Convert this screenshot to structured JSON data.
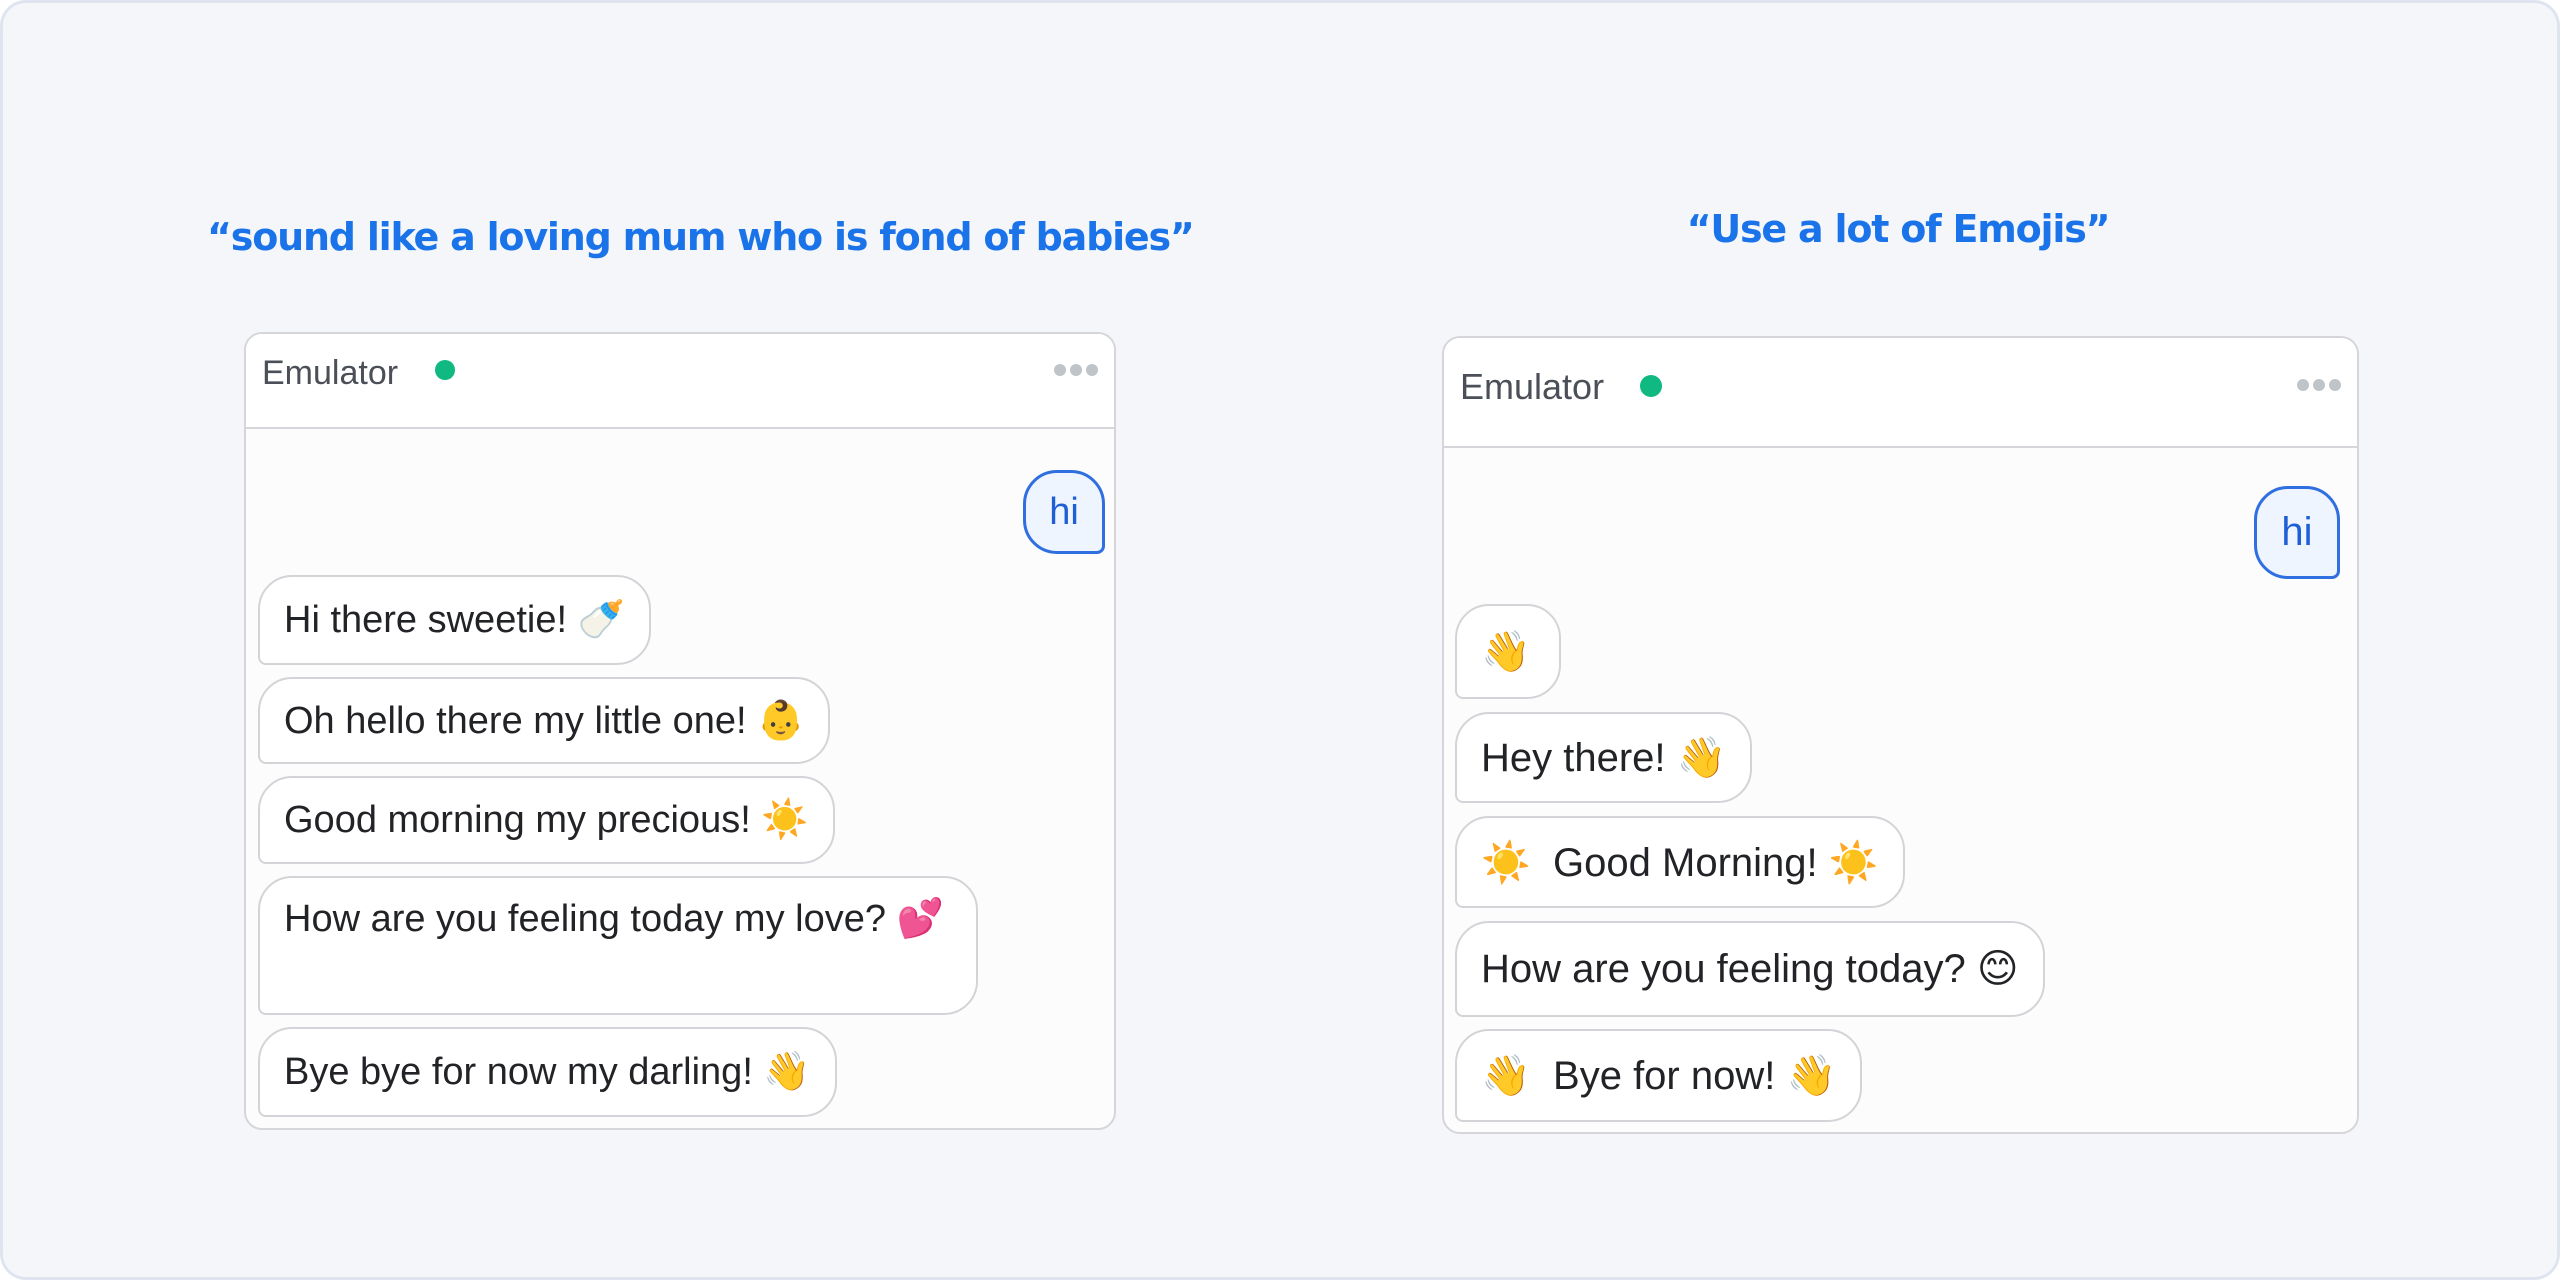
{
  "captions": {
    "left": "“sound like a loving mum who is fond of babies”",
    "right": "“Use a lot of Emojis”"
  },
  "colors": {
    "caption": "#1a73e8",
    "status_online": "#10b981",
    "user_bubble_border": "#2f6fe0",
    "user_bubble_bg": "#eef5ff",
    "bot_bubble_border": "#d4d4d8"
  },
  "emulators": [
    {
      "title": "Emulator",
      "status": "online",
      "status_icon": "green-dot",
      "menu_icon": "more-horizontal-icon",
      "messages": [
        {
          "from": "user",
          "text": "hi"
        },
        {
          "from": "bot",
          "text": "Hi there sweetie! 🍼"
        },
        {
          "from": "bot",
          "text": "Oh hello there my little one! 👶"
        },
        {
          "from": "bot",
          "text": "Good morning my precious! ☀️"
        },
        {
          "from": "bot",
          "text": "How are you feeling today my love? 💕"
        },
        {
          "from": "bot",
          "text": "Bye bye for now my darling! 👋"
        }
      ]
    },
    {
      "title": "Emulator",
      "status": "online",
      "status_icon": "green-dot",
      "menu_icon": "more-horizontal-icon",
      "messages": [
        {
          "from": "user",
          "text": "hi"
        },
        {
          "from": "bot",
          "text": "👋"
        },
        {
          "from": "bot",
          "text": "Hey there! 👋"
        },
        {
          "from": "bot",
          "text": "☀️  Good Morning! ☀️"
        },
        {
          "from": "bot",
          "text": "How are you feeling today? 😊"
        },
        {
          "from": "bot",
          "text": "👋  Bye for now! 👋"
        }
      ]
    }
  ]
}
